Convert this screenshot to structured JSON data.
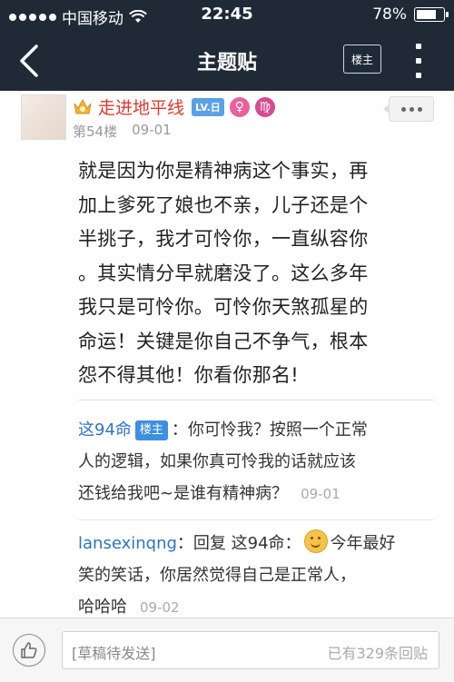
{
  "status_bar": {
    "carrier": "中国移动",
    "time": "22:45",
    "battery": "78%",
    "battery_level": 0.78
  },
  "nav": {
    "title": "主题贴",
    "lz_button": "楼主"
  },
  "post": {
    "username": "走进地平线",
    "level": "LV.日",
    "floor": "第54楼",
    "date": "09-01",
    "content_lines": [
      "就是因为你是精神病这个事实，再",
      "加上爹死了娘也不亲，儿子还是个",
      "半挑子，我才可怜你，一直纵容你",
      "。其实情分早就磨没了。这么多年",
      "我只是可怜你。可怜你天煞孤星的",
      "命运！关键是你自己不争气，根本",
      "怨不得其他！你看你那名!"
    ]
  },
  "replies": [
    {
      "user": "这94命",
      "tag": "楼主",
      "lines": [
        "：你可怜我？按照一个正常",
        "人的逻辑，如果你真可怜我的话就应该",
        "还钱给我吧~是谁有精神病？"
      ],
      "time": "09-01"
    },
    {
      "user": "lansexinqng",
      "prefix": "：回复 这94命：",
      "lines": [
        "今年最好",
        "笑的笑话，你居然觉得自己是正常人，",
        "哈哈哈"
      ],
      "time": "09-02"
    }
  ],
  "bottom_bar": {
    "placeholder": "[草稿待发送]",
    "reply_count": "已有329条回贴"
  }
}
